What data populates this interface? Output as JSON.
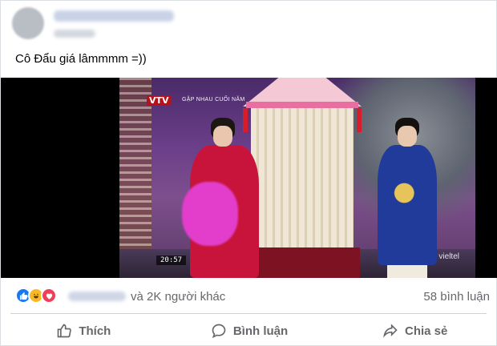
{
  "post": {
    "caption": "Cô Đẩu giá lâmmmm =))"
  },
  "video": {
    "channel_logo": "VTV",
    "show_title": "GẶP NHAU CUỐI NĂM",
    "timestamp": "20:57",
    "watermark": "vieltel"
  },
  "reactions": {
    "icons": [
      "like-icon",
      "haha-icon",
      "love-icon"
    ],
    "others_text": "và 2K người khác",
    "comments_text": "58 bình luận"
  },
  "actions": [
    {
      "label": "Thích",
      "icon": "thumbs-up-icon"
    },
    {
      "label": "Bình luận",
      "icon": "comment-icon"
    },
    {
      "label": "Chia sẻ",
      "icon": "share-icon"
    }
  ],
  "colors": {
    "like": "#1877f2",
    "haha": "#f7b928",
    "love": "#f33e58",
    "muted_text": "#65676b"
  }
}
